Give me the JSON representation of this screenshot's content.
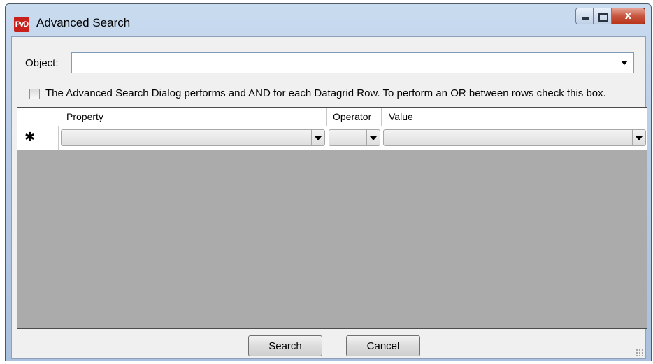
{
  "window": {
    "title": "Advanced Search",
    "icon_text": "PvD",
    "close_glyph": "x"
  },
  "object_field": {
    "label": "Object:",
    "value": ""
  },
  "or_checkbox": {
    "checked": false,
    "label": "The Advanced Search Dialog performs and AND for each Datagrid Row.  To perform an OR between rows check this box."
  },
  "grid": {
    "columns": [
      "Property",
      "Operator",
      "Value"
    ],
    "new_row_marker": "✱",
    "rows": [
      {
        "property": "",
        "operator": "",
        "value": ""
      }
    ]
  },
  "buttons": {
    "search": "Search",
    "cancel": "Cancel"
  },
  "colors": {
    "grid_background": "#ababab",
    "close_button": "#c7553f",
    "app_icon": "#c8201a"
  }
}
